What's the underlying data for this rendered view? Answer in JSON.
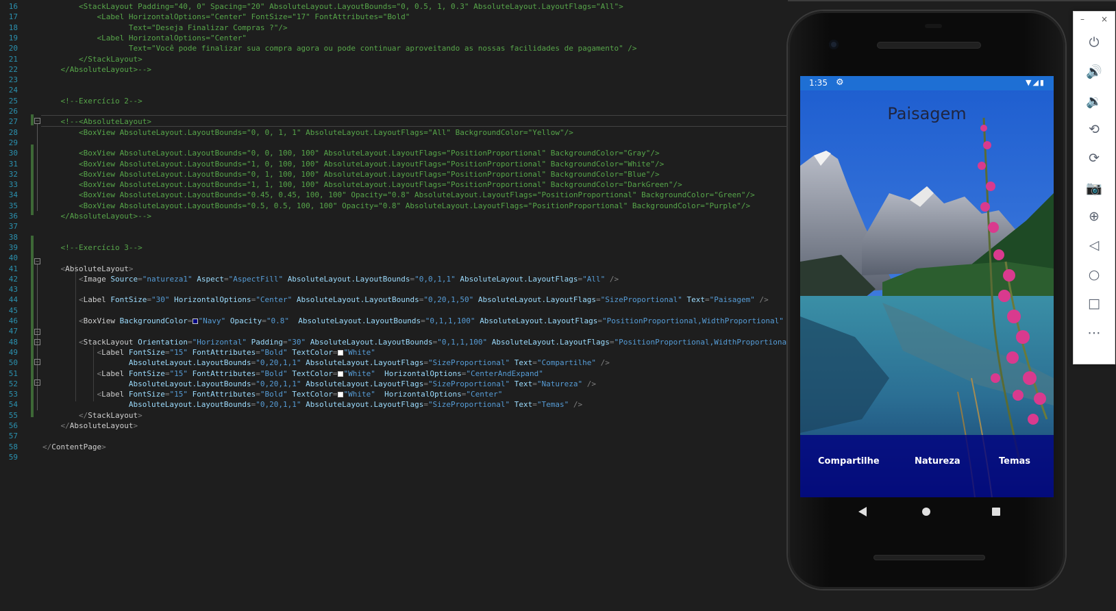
{
  "editor": {
    "lines": [
      {
        "n": "16",
        "segments": [
          {
            "c": "cmt",
            "t": "        <StackLayout Padding=\"40, 0\" Spacing=\"20\" AbsoluteLayout.LayoutBounds=\"0, 0.5, 1, 0.3\" AbsoluteLayout.LayoutFlags=\"All\">"
          }
        ]
      },
      {
        "n": "17",
        "segments": [
          {
            "c": "cmt",
            "t": "            <Label HorizontalOptions=\"Center\" FontSize=\"17\" FontAttributes=\"Bold\""
          }
        ]
      },
      {
        "n": "18",
        "segments": [
          {
            "c": "cmt",
            "t": "                   Text=\"Deseja Finalizar Compras ?\"/>"
          }
        ]
      },
      {
        "n": "19",
        "segments": [
          {
            "c": "cmt",
            "t": "            <Label HorizontalOptions=\"Center\""
          }
        ]
      },
      {
        "n": "20",
        "segments": [
          {
            "c": "cmt",
            "t": "                   Text=\"Você pode finalizar sua compra agora ou pode continuar aproveitando as nossas facilidades de pagamento\" />"
          }
        ]
      },
      {
        "n": "21",
        "segments": [
          {
            "c": "cmt",
            "t": "        </StackLayout>"
          }
        ]
      },
      {
        "n": "22",
        "segments": [
          {
            "c": "cmt",
            "t": "    </AbsoluteLayout>-->"
          }
        ]
      },
      {
        "n": "23",
        "segments": []
      },
      {
        "n": "24",
        "segments": []
      },
      {
        "n": "25",
        "segments": [
          {
            "c": "cmt",
            "t": "    <!--Exercício 2-->"
          }
        ]
      },
      {
        "n": "26",
        "segments": []
      },
      {
        "n": "27",
        "segments": [
          {
            "c": "cmt",
            "t": "    <!--<AbsoluteLayout>"
          }
        ]
      },
      {
        "n": "28",
        "segments": [
          {
            "c": "cmt",
            "t": "        <BoxView AbsoluteLayout.LayoutBounds=\"0, 0, 1, 1\" AbsoluteLayout.LayoutFlags=\"All\" BackgroundColor=\"Yellow\"/>"
          }
        ]
      },
      {
        "n": "29",
        "segments": []
      },
      {
        "n": "30",
        "segments": [
          {
            "c": "cmt",
            "t": "        <BoxView AbsoluteLayout.LayoutBounds=\"0, 0, 100, 100\" AbsoluteLayout.LayoutFlags=\"PositionProportional\" BackgroundColor=\"Gray\"/>"
          }
        ]
      },
      {
        "n": "31",
        "segments": [
          {
            "c": "cmt",
            "t": "        <BoxView AbsoluteLayout.LayoutBounds=\"1, 0, 100, 100\" AbsoluteLayout.LayoutFlags=\"PositionProportional\" BackgroundColor=\"White\"/>"
          }
        ]
      },
      {
        "n": "32",
        "segments": [
          {
            "c": "cmt",
            "t": "        <BoxView AbsoluteLayout.LayoutBounds=\"0, 1, 100, 100\" AbsoluteLayout.LayoutFlags=\"PositionProportional\" BackgroundColor=\"Blue\"/>"
          }
        ]
      },
      {
        "n": "33",
        "segments": [
          {
            "c": "cmt",
            "t": "        <BoxView AbsoluteLayout.LayoutBounds=\"1, 1, 100, 100\" AbsoluteLayout.LayoutFlags=\"PositionProportional\" BackgroundColor=\"DarkGreen\"/>"
          }
        ]
      },
      {
        "n": "34",
        "segments": [
          {
            "c": "cmt",
            "t": "        <BoxView AbsoluteLayout.LayoutBounds=\"0.45, 0.45, 100, 100\" Opacity=\"0.8\" AbsoluteLayout.LayoutFlags=\"PositionProportional\" BackgroundColor=\"Green\"/>"
          }
        ]
      },
      {
        "n": "35",
        "segments": [
          {
            "c": "cmt",
            "t": "        <BoxView AbsoluteLayout.LayoutBounds=\"0.5, 0.5, 100, 100\" Opacity=\"0.8\" AbsoluteLayout.LayoutFlags=\"PositionProportional\" BackgroundColor=\"Purple\"/>"
          }
        ]
      },
      {
        "n": "36",
        "segments": [
          {
            "c": "cmt",
            "t": "    </AbsoluteLayout>-->"
          }
        ]
      },
      {
        "n": "37",
        "segments": []
      },
      {
        "n": "38",
        "segments": []
      },
      {
        "n": "39",
        "segments": [
          {
            "c": "cmt",
            "t": "    <!--Exercício 3-->"
          }
        ]
      },
      {
        "n": "40",
        "segments": []
      },
      {
        "n": "41",
        "segments": [
          {
            "c": "tag",
            "t": "    <"
          },
          {
            "c": "el",
            "t": "AbsoluteLayout"
          },
          {
            "c": "tag",
            "t": ">"
          }
        ]
      },
      {
        "n": "42",
        "segments": [
          {
            "c": "tag",
            "t": "        <"
          },
          {
            "c": "el",
            "t": "Image "
          },
          {
            "c": "attr",
            "t": "Source"
          },
          {
            "c": "tag",
            "t": "="
          },
          {
            "c": "val",
            "t": "\"natureza1\" "
          },
          {
            "c": "attr",
            "t": "Aspect"
          },
          {
            "c": "tag",
            "t": "="
          },
          {
            "c": "val",
            "t": "\"AspectFill\" "
          },
          {
            "c": "attr",
            "t": "AbsoluteLayout.LayoutBounds"
          },
          {
            "c": "tag",
            "t": "="
          },
          {
            "c": "val",
            "t": "\"0,0,1,1\" "
          },
          {
            "c": "attr",
            "t": "AbsoluteLayout.LayoutFlags"
          },
          {
            "c": "tag",
            "t": "="
          },
          {
            "c": "val",
            "t": "\"All\" "
          },
          {
            "c": "tag",
            "t": "/>"
          }
        ]
      },
      {
        "n": "43",
        "segments": []
      },
      {
        "n": "44",
        "segments": [
          {
            "c": "tag",
            "t": "        <"
          },
          {
            "c": "el",
            "t": "Label "
          },
          {
            "c": "attr",
            "t": "FontSize"
          },
          {
            "c": "tag",
            "t": "="
          },
          {
            "c": "val",
            "t": "\"30\" "
          },
          {
            "c": "attr",
            "t": "HorizontalOptions"
          },
          {
            "c": "tag",
            "t": "="
          },
          {
            "c": "val",
            "t": "\"Center\" "
          },
          {
            "c": "attr",
            "t": "AbsoluteLayout.LayoutBounds"
          },
          {
            "c": "tag",
            "t": "="
          },
          {
            "c": "val",
            "t": "\"0,20,1,50\" "
          },
          {
            "c": "attr",
            "t": "AbsoluteLayout.LayoutFlags"
          },
          {
            "c": "tag",
            "t": "="
          },
          {
            "c": "val",
            "t": "\"SizeProportional\" "
          },
          {
            "c": "attr",
            "t": "Text"
          },
          {
            "c": "tag",
            "t": "="
          },
          {
            "c": "val",
            "t": "\"Paisagem\" "
          },
          {
            "c": "tag",
            "t": "/>"
          }
        ]
      },
      {
        "n": "45",
        "segments": []
      },
      {
        "n": "46",
        "segments": [
          {
            "c": "tag",
            "t": "        <"
          },
          {
            "c": "el",
            "t": "BoxView "
          },
          {
            "c": "attr",
            "t": "BackgroundColor"
          },
          {
            "c": "tag",
            "t": "="
          },
          {
            "c": "swatch",
            "t": "#000080"
          },
          {
            "c": "val",
            "t": "\"Navy\" "
          },
          {
            "c": "attr",
            "t": "Opacity"
          },
          {
            "c": "tag",
            "t": "="
          },
          {
            "c": "val",
            "t": "\"0.8\"  "
          },
          {
            "c": "attr",
            "t": "AbsoluteLayout.LayoutBounds"
          },
          {
            "c": "tag",
            "t": "="
          },
          {
            "c": "val",
            "t": "\"0,1,1,100\" "
          },
          {
            "c": "attr",
            "t": "AbsoluteLayout.LayoutFlags"
          },
          {
            "c": "tag",
            "t": "="
          },
          {
            "c": "val",
            "t": "\"PositionProportional,WidthProportional\" "
          },
          {
            "c": "tag",
            "t": "/>"
          }
        ]
      },
      {
        "n": "47",
        "segments": []
      },
      {
        "n": "48",
        "segments": [
          {
            "c": "tag",
            "t": "        <"
          },
          {
            "c": "el",
            "t": "StackLayout "
          },
          {
            "c": "attr",
            "t": "Orientation"
          },
          {
            "c": "tag",
            "t": "="
          },
          {
            "c": "val",
            "t": "\"Horizontal\" "
          },
          {
            "c": "attr",
            "t": "Padding"
          },
          {
            "c": "tag",
            "t": "="
          },
          {
            "c": "val",
            "t": "\"30\" "
          },
          {
            "c": "attr",
            "t": "AbsoluteLayout.LayoutBounds"
          },
          {
            "c": "tag",
            "t": "="
          },
          {
            "c": "val",
            "t": "\"0,1,1,100\" "
          },
          {
            "c": "attr",
            "t": "AbsoluteLayout.LayoutFlags"
          },
          {
            "c": "tag",
            "t": "="
          },
          {
            "c": "val",
            "t": "\"PositionProportional,WidthProportional\""
          },
          {
            "c": "tag",
            "t": ">"
          }
        ]
      },
      {
        "n": "49",
        "segments": [
          {
            "c": "tag",
            "t": "            <"
          },
          {
            "c": "el",
            "t": "Label "
          },
          {
            "c": "attr",
            "t": "FontSize"
          },
          {
            "c": "tag",
            "t": "="
          },
          {
            "c": "val",
            "t": "\"15\" "
          },
          {
            "c": "attr",
            "t": "FontAttributes"
          },
          {
            "c": "tag",
            "t": "="
          },
          {
            "c": "val",
            "t": "\"Bold\" "
          },
          {
            "c": "attr",
            "t": "TextColor"
          },
          {
            "c": "tag",
            "t": "="
          },
          {
            "c": "swatch",
            "t": "#ffffff"
          },
          {
            "c": "val",
            "t": "\"White\""
          }
        ]
      },
      {
        "n": "50",
        "segments": [
          {
            "c": "attr",
            "t": "                   AbsoluteLayout.LayoutBounds"
          },
          {
            "c": "tag",
            "t": "="
          },
          {
            "c": "val",
            "t": "\"0,20,1,1\" "
          },
          {
            "c": "attr",
            "t": "AbsoluteLayout.LayoutFlags"
          },
          {
            "c": "tag",
            "t": "="
          },
          {
            "c": "val",
            "t": "\"SizeProportional\" "
          },
          {
            "c": "attr",
            "t": "Text"
          },
          {
            "c": "tag",
            "t": "="
          },
          {
            "c": "val",
            "t": "\"Compartilhe\" "
          },
          {
            "c": "tag",
            "t": "/>"
          }
        ]
      },
      {
        "n": "51",
        "segments": [
          {
            "c": "tag",
            "t": "            <"
          },
          {
            "c": "el",
            "t": "Label "
          },
          {
            "c": "attr",
            "t": "FontSize"
          },
          {
            "c": "tag",
            "t": "="
          },
          {
            "c": "val",
            "t": "\"15\" "
          },
          {
            "c": "attr",
            "t": "FontAttributes"
          },
          {
            "c": "tag",
            "t": "="
          },
          {
            "c": "val",
            "t": "\"Bold\" "
          },
          {
            "c": "attr",
            "t": "TextColor"
          },
          {
            "c": "tag",
            "t": "="
          },
          {
            "c": "swatch",
            "t": "#ffffff"
          },
          {
            "c": "val",
            "t": "\"White\"  "
          },
          {
            "c": "attr",
            "t": "HorizontalOptions"
          },
          {
            "c": "tag",
            "t": "="
          },
          {
            "c": "val",
            "t": "\"CenterAndExpand\""
          }
        ]
      },
      {
        "n": "52",
        "segments": [
          {
            "c": "attr",
            "t": "                   AbsoluteLayout.LayoutBounds"
          },
          {
            "c": "tag",
            "t": "="
          },
          {
            "c": "val",
            "t": "\"0,20,1,1\" "
          },
          {
            "c": "attr",
            "t": "AbsoluteLayout.LayoutFlags"
          },
          {
            "c": "tag",
            "t": "="
          },
          {
            "c": "val",
            "t": "\"SizeProportional\" "
          },
          {
            "c": "attr",
            "t": "Text"
          },
          {
            "c": "tag",
            "t": "="
          },
          {
            "c": "val",
            "t": "\"Natureza\" "
          },
          {
            "c": "tag",
            "t": "/>"
          }
        ]
      },
      {
        "n": "53",
        "segments": [
          {
            "c": "tag",
            "t": "            <"
          },
          {
            "c": "el",
            "t": "Label "
          },
          {
            "c": "attr",
            "t": "FontSize"
          },
          {
            "c": "tag",
            "t": "="
          },
          {
            "c": "val",
            "t": "\"15\" "
          },
          {
            "c": "attr",
            "t": "FontAttributes"
          },
          {
            "c": "tag",
            "t": "="
          },
          {
            "c": "val",
            "t": "\"Bold\" "
          },
          {
            "c": "attr",
            "t": "TextColor"
          },
          {
            "c": "tag",
            "t": "="
          },
          {
            "c": "swatch",
            "t": "#ffffff"
          },
          {
            "c": "val",
            "t": "\"White\"  "
          },
          {
            "c": "attr",
            "t": "HorizontalOptions"
          },
          {
            "c": "tag",
            "t": "="
          },
          {
            "c": "val",
            "t": "\"Center\""
          }
        ]
      },
      {
        "n": "54",
        "segments": [
          {
            "c": "attr",
            "t": "                   AbsoluteLayout.LayoutBounds"
          },
          {
            "c": "tag",
            "t": "="
          },
          {
            "c": "val",
            "t": "\"0,20,1,1\" "
          },
          {
            "c": "attr",
            "t": "AbsoluteLayout.LayoutFlags"
          },
          {
            "c": "tag",
            "t": "="
          },
          {
            "c": "val",
            "t": "\"SizeProportional\" "
          },
          {
            "c": "attr",
            "t": "Text"
          },
          {
            "c": "tag",
            "t": "="
          },
          {
            "c": "val",
            "t": "\"Temas\" "
          },
          {
            "c": "tag",
            "t": "/>"
          }
        ]
      },
      {
        "n": "55",
        "segments": [
          {
            "c": "tag",
            "t": "        </"
          },
          {
            "c": "el",
            "t": "StackLayout"
          },
          {
            "c": "tag",
            "t": ">"
          }
        ]
      },
      {
        "n": "56",
        "segments": [
          {
            "c": "tag",
            "t": "    </"
          },
          {
            "c": "el",
            "t": "AbsoluteLayout"
          },
          {
            "c": "tag",
            "t": ">"
          }
        ]
      },
      {
        "n": "57",
        "segments": []
      },
      {
        "n": "58",
        "segments": [
          {
            "c": "tag",
            "t": "</"
          },
          {
            "c": "el",
            "t": "ContentPage"
          },
          {
            "c": "tag",
            "t": ">"
          }
        ]
      },
      {
        "n": "59",
        "segments": []
      }
    ]
  },
  "phone": {
    "status_time": "1:35",
    "status_icons": "▼◢▮",
    "app_title": "Paisagem",
    "bottom_labels": {
      "compartilhe": "Compartilhe",
      "natureza": "Natureza",
      "temas": "Temas"
    },
    "colors": {
      "status_bar": "#1e6fd4",
      "bottom_bar": "#000080"
    }
  },
  "emulator_toolbar": {
    "minimize": "–",
    "close": "×",
    "buttons": [
      {
        "name": "power-icon",
        "glyph": "⏻"
      },
      {
        "name": "volume-up-icon",
        "glyph": "🔊"
      },
      {
        "name": "volume-down-icon",
        "glyph": "🔉"
      },
      {
        "name": "rotate-left-icon",
        "glyph": "⟲"
      },
      {
        "name": "rotate-right-icon",
        "glyph": "⟳"
      },
      {
        "name": "camera-icon",
        "glyph": "📷"
      },
      {
        "name": "zoom-icon",
        "glyph": "⊕"
      },
      {
        "name": "back-icon",
        "glyph": "◁"
      },
      {
        "name": "home-icon",
        "glyph": "○"
      },
      {
        "name": "overview-icon",
        "glyph": "□"
      },
      {
        "name": "more-icon",
        "glyph": "⋯"
      }
    ]
  }
}
